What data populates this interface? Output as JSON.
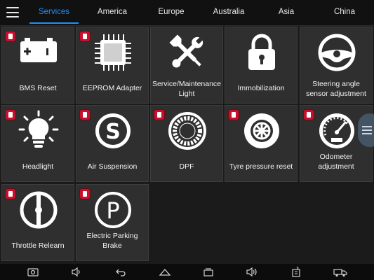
{
  "tabs": [
    {
      "label": "Services",
      "active": true
    },
    {
      "label": "America",
      "active": false
    },
    {
      "label": "Europe",
      "active": false
    },
    {
      "label": "Australia",
      "active": false
    },
    {
      "label": "Asia",
      "active": false
    },
    {
      "label": "China",
      "active": false
    }
  ],
  "colors": {
    "accent": "#1e90ff",
    "tile_bg": "#2f2f2f",
    "badge": "#c8102e"
  },
  "tiles": [
    {
      "label": "BMS Reset",
      "icon": "battery-icon"
    },
    {
      "label": "EEPROM Adapter",
      "icon": "chip-icon"
    },
    {
      "label": "Service/Maintenance Light",
      "icon": "wrench-screwdriver-icon"
    },
    {
      "label": "Immobilization",
      "icon": "padlock-icon"
    },
    {
      "label": "Steering angle sensor adjustment",
      "icon": "steering-wheel-icon"
    },
    {
      "label": "Headlight",
      "icon": "lightbulb-icon"
    },
    {
      "label": "Air Suspension",
      "icon": "suspension-s-icon"
    },
    {
      "label": "DPF",
      "icon": "dpf-filter-icon"
    },
    {
      "label": "Tyre pressure reset",
      "icon": "tyre-icon"
    },
    {
      "label": "Odometer adjustment",
      "icon": "odometer-icon"
    },
    {
      "label": "Throttle Relearn",
      "icon": "throttle-icon"
    },
    {
      "label": "Electric Parking Brake",
      "icon": "parking-brake-icon"
    }
  ],
  "navbar": [
    "camera-icon",
    "volume-down-icon",
    "back-icon",
    "home-icon",
    "recent-apps-icon",
    "volume-up-icon",
    "vci-icon",
    "truck-icon"
  ]
}
